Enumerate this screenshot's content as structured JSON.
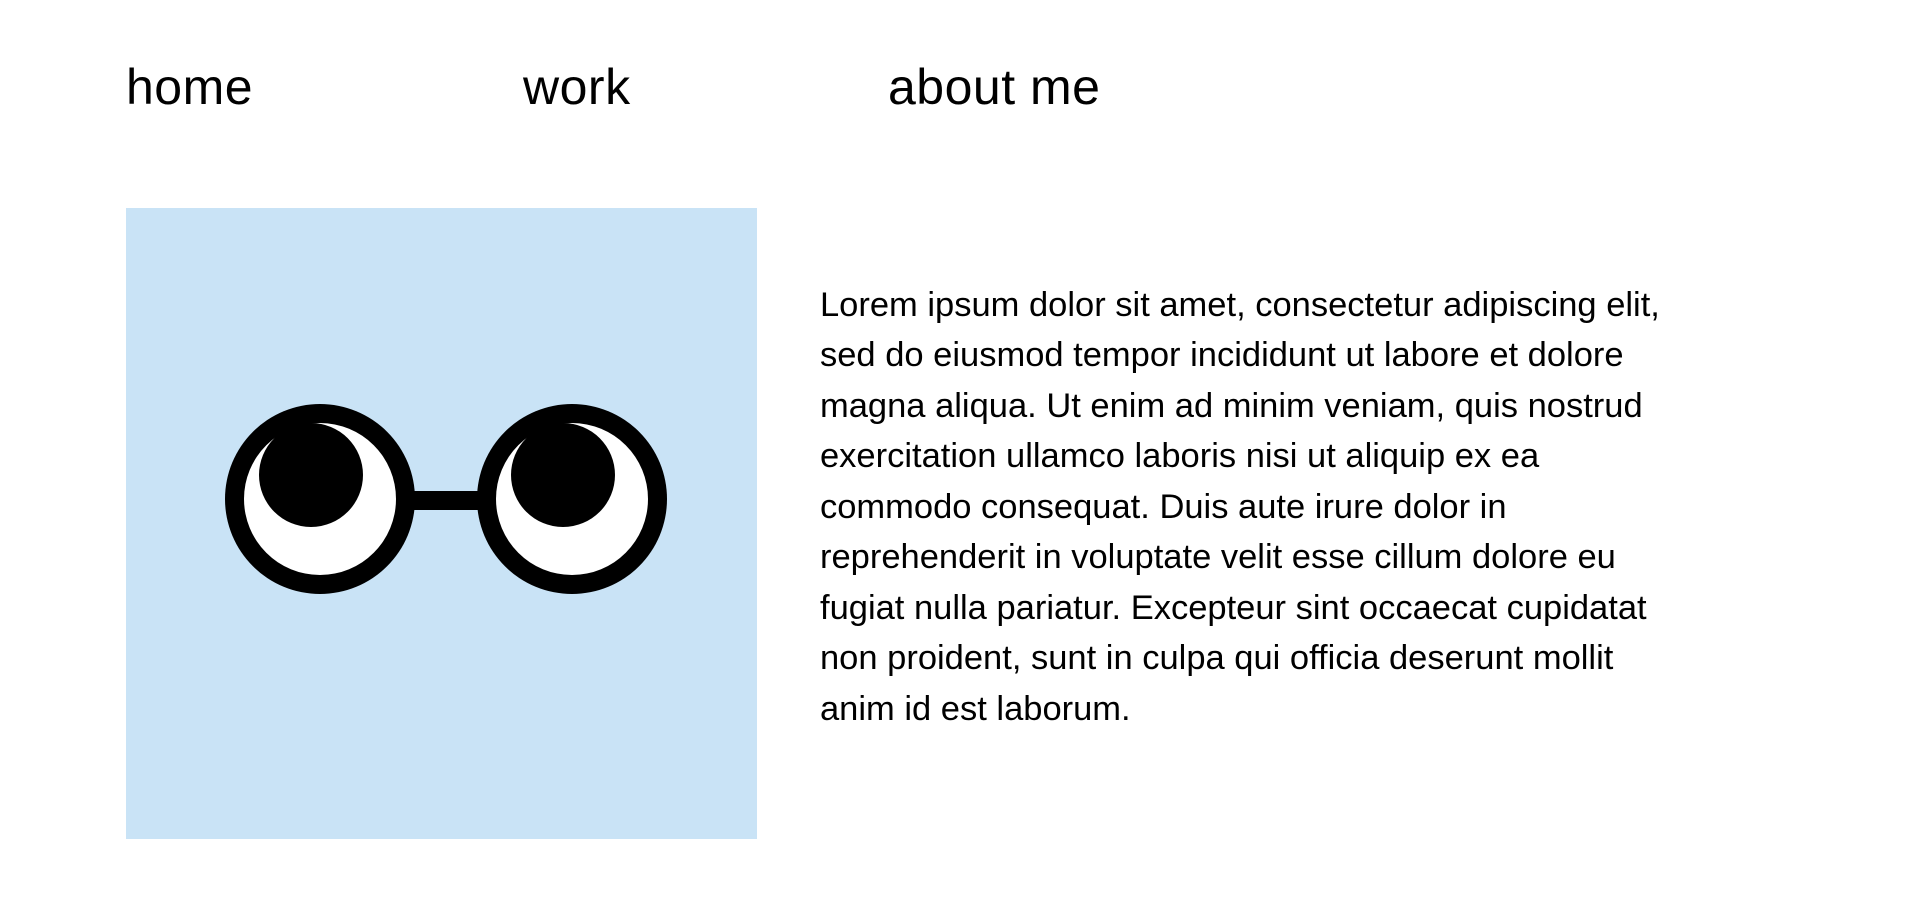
{
  "nav": {
    "items": [
      {
        "label": "home"
      },
      {
        "label": "work"
      },
      {
        "label": "about me"
      }
    ]
  },
  "hero": {
    "icon": "glasses-eyes-icon",
    "background_color": "#c9e3f6"
  },
  "bio": {
    "text": "Lorem ipsum dolor sit amet, consectetur adipiscing elit,\nsed do eiusmod tempor incididunt ut labore et dolore\nmagna aliqua. Ut enim ad minim veniam, quis nostrud\nexercitation ullamco laboris nisi ut aliquip ex ea\ncommodo consequat. Duis aute irure dolor in\nreprehenderit in voluptate velit esse cillum dolore eu\nfugiat nulla pariatur. Excepteur sint occaecat cupidatat\nnon proident, sunt in culpa qui officia deserunt mollit\nanim id est laborum."
  }
}
